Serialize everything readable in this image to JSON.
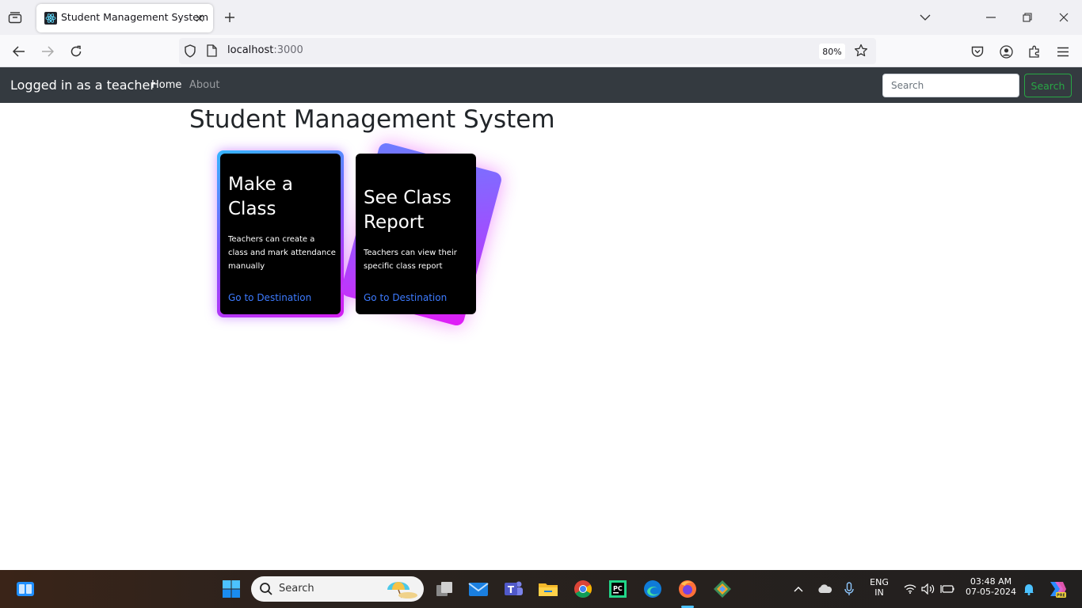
{
  "browser": {
    "tab_title": "Student Management System",
    "url_host": "localhost",
    "url_port": ":3000",
    "zoom": "80%"
  },
  "site": {
    "brand": "Logged in as a teacher",
    "nav": [
      {
        "label": "Home",
        "active": true
      },
      {
        "label": "About",
        "active": false
      }
    ],
    "search_placeholder": "Search",
    "search_button": "Search"
  },
  "page": {
    "title": "Student Management System",
    "cards": [
      {
        "title": "Make a Class",
        "description": "Teachers can create a class and mark attendance manually",
        "link": "Go to Destination"
      },
      {
        "title": "See Class Report",
        "description": "Teachers can view their specific class report",
        "link": "Go to Destination"
      }
    ]
  },
  "taskbar": {
    "search_label": "Search",
    "lang_top": "ENG",
    "lang_bottom": "IN",
    "time": "03:48 AM",
    "date": "07-05-2024"
  },
  "colors": {
    "site_nav_bg": "#343a40",
    "search_button": "#28a745",
    "card_link": "#3d7bff",
    "card_bg": "#000000"
  }
}
